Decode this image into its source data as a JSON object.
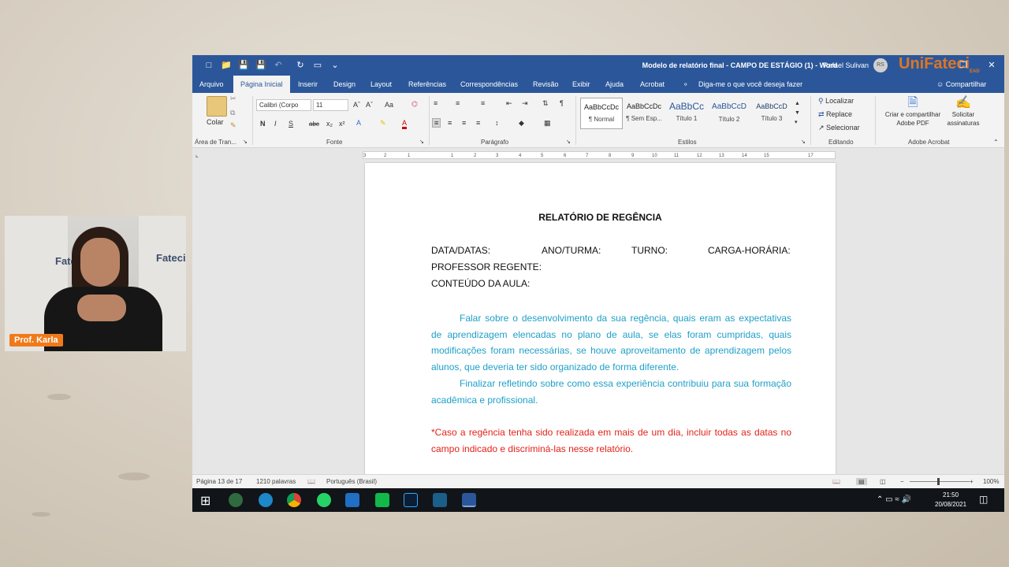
{
  "word": {
    "title": "Modelo de relatório final - CAMPO DE ESTÁGIO (1)  -  Word",
    "user": "Rafael Sulivan",
    "user_initials": "RS",
    "tabs": [
      "Arquivo",
      "Página Inicial",
      "Inserir",
      "Design",
      "Layout",
      "Referências",
      "Correspondências",
      "Revisão",
      "Exibir",
      "Ajuda",
      "Acrobat"
    ],
    "active_tab": "Página Inicial",
    "tell_me": "Diga-me o que você deseja fazer",
    "share": "Compartilhar",
    "ribbon": {
      "paste_label": "Colar",
      "clipboard_label": "Área de Tran...",
      "font_name": "Calibri (Corpo",
      "font_size": "11",
      "font_label": "Fonte",
      "paragraph_label": "Parágrafo",
      "styles_label": "Estilos",
      "styles": [
        {
          "preview": "AaBbCcDc",
          "name": "¶ Normal"
        },
        {
          "preview": "AaBbCcDc",
          "name": "¶ Sem Esp..."
        },
        {
          "preview": "AaBbCc",
          "name": "Título 1"
        },
        {
          "preview": "AaBbCcD",
          "name": "Título 2"
        },
        {
          "preview": "AaBbCcD",
          "name": "Título 3"
        }
      ],
      "find": "Localizar",
      "replace": "Replace",
      "select": "Selecionar",
      "editing_label": "Editando",
      "create_pdf": "Criar e compartilhar",
      "create_pdf2": "Adobe PDF",
      "request_sign": "Solicitar",
      "request_sign2": "assinaturas",
      "acrobat_label": "Adobe Acrobat"
    },
    "ruler_ticks": [
      "3",
      "2",
      "1",
      "1",
      "2",
      "3",
      "4",
      "5",
      "6",
      "7",
      "8",
      "9",
      "10",
      "11",
      "12",
      "13",
      "14",
      "15",
      "17"
    ],
    "document": {
      "title": "RELATÓRIO DE REGÊNCIA",
      "field1": "DATA/DATAS:",
      "field2": "ANO/TURMA:",
      "field3": "TURNO:",
      "field4": "CARGA-HORÁRIA:",
      "teacher": "PROFESSOR REGENTE:",
      "content": "CONTEÚDO DA AULA:",
      "para1": "Falar sobre o desenvolvimento da sua regência, quais eram as expectativas de aprendizagem elencadas no plano de aula, se elas foram cumpridas, quais modificações foram necessárias, se houve aproveitamento de aprendizagem pelos alunos, que deveria ter sido organizado de forma diferente.",
      "para2": "Finalizar refletindo sobre como essa experiência contribuiu para sua formação acadêmica e profissional.",
      "note": "*Caso a regência tenha sido realizada em mais de um dia, incluir todas as datas no campo indicado e discriminá-las nesse relatório."
    },
    "status": {
      "page": "Página 13 de 17",
      "words": "1210 palavras",
      "language": "Português (Brasil)",
      "zoom": "100%"
    },
    "taskbar": {
      "time": "21:50",
      "date": "20/08/2021"
    }
  },
  "webcam": {
    "name_tag": "Prof. Karla",
    "logo": "Fateci"
  },
  "brand": {
    "logo": "UniFateci",
    "logo_sub": "EAD"
  },
  "colors": {
    "word_blue": "#2b579a",
    "doc_blue": "#1fa0c8",
    "doc_red": "#e2231a",
    "brand_orange": "#f07a1a"
  }
}
